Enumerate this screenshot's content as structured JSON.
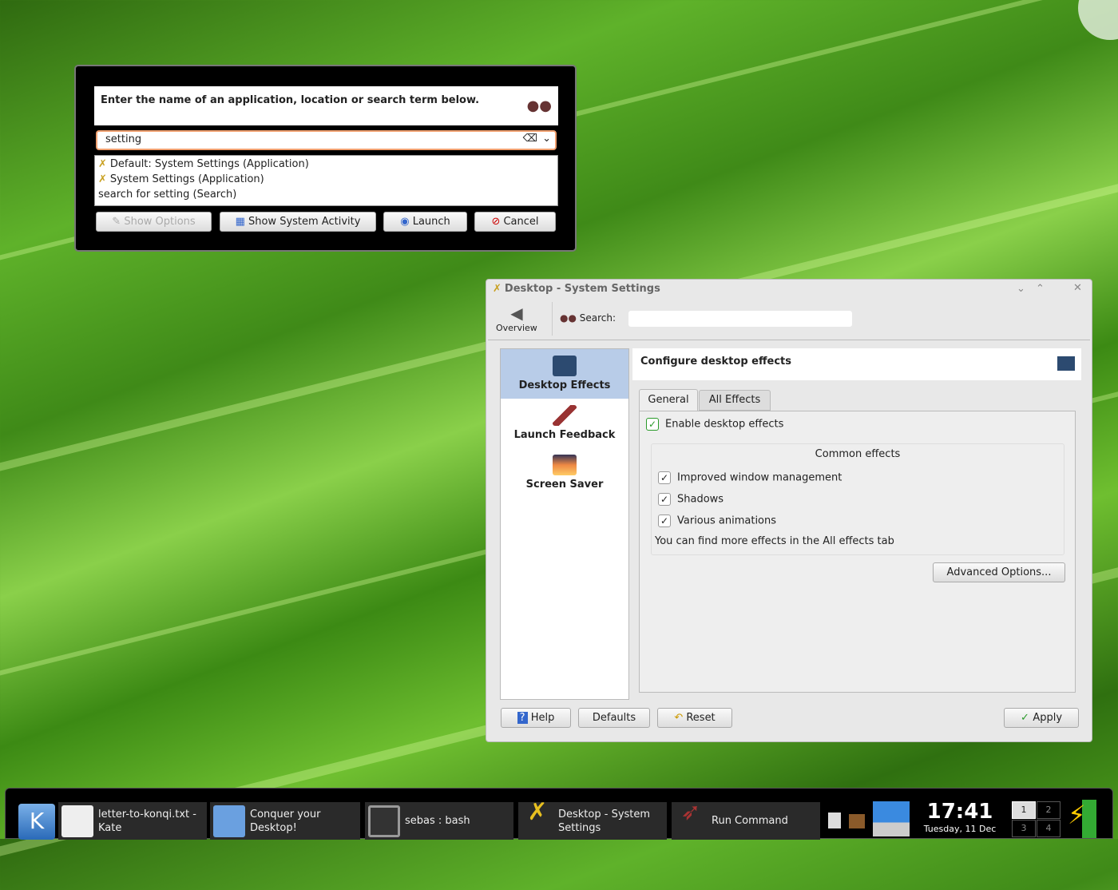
{
  "runner": {
    "prompt": "Enter the name of an application, location or search term below.",
    "query": "setting",
    "results": [
      "Default: System Settings (Application)",
      "System Settings (Application)",
      "search for setting (Search)"
    ],
    "buttons": {
      "options": "Show Options",
      "activity": "Show System Activity",
      "launch": "Launch",
      "cancel": "Cancel"
    }
  },
  "settings": {
    "title": "Desktop - System Settings",
    "overview": "Overview",
    "search_label": "Search:",
    "search_value": "",
    "categories": [
      "Desktop Effects",
      "Launch Feedback",
      "Screen Saver"
    ],
    "header": "Configure desktop effects",
    "tabs": [
      "General",
      "All Effects"
    ],
    "enable": "Enable desktop effects",
    "group_title": "Common effects",
    "effects": [
      "Improved window management",
      "Shadows",
      "Various animations"
    ],
    "note": "You can find more effects in the All effects tab",
    "advanced": "Advanced Options...",
    "buttons": {
      "help": "Help",
      "defaults": "Defaults",
      "reset": "Reset",
      "apply": "Apply"
    }
  },
  "taskbar": {
    "tasks": [
      "letter-to-konqi.txt - Kate",
      "Conquer your Desktop!",
      "sebas : bash",
      "Desktop - System Settings",
      "Run Command"
    ],
    "time": "17:41",
    "date": "Tuesday, 11 Dec",
    "desktops": [
      "1",
      "2",
      "3",
      "4"
    ]
  },
  "colors": {
    "selected_category": "#b8cce8",
    "accent_check": "#2a9a2a",
    "input_focus": "#f0a070"
  }
}
